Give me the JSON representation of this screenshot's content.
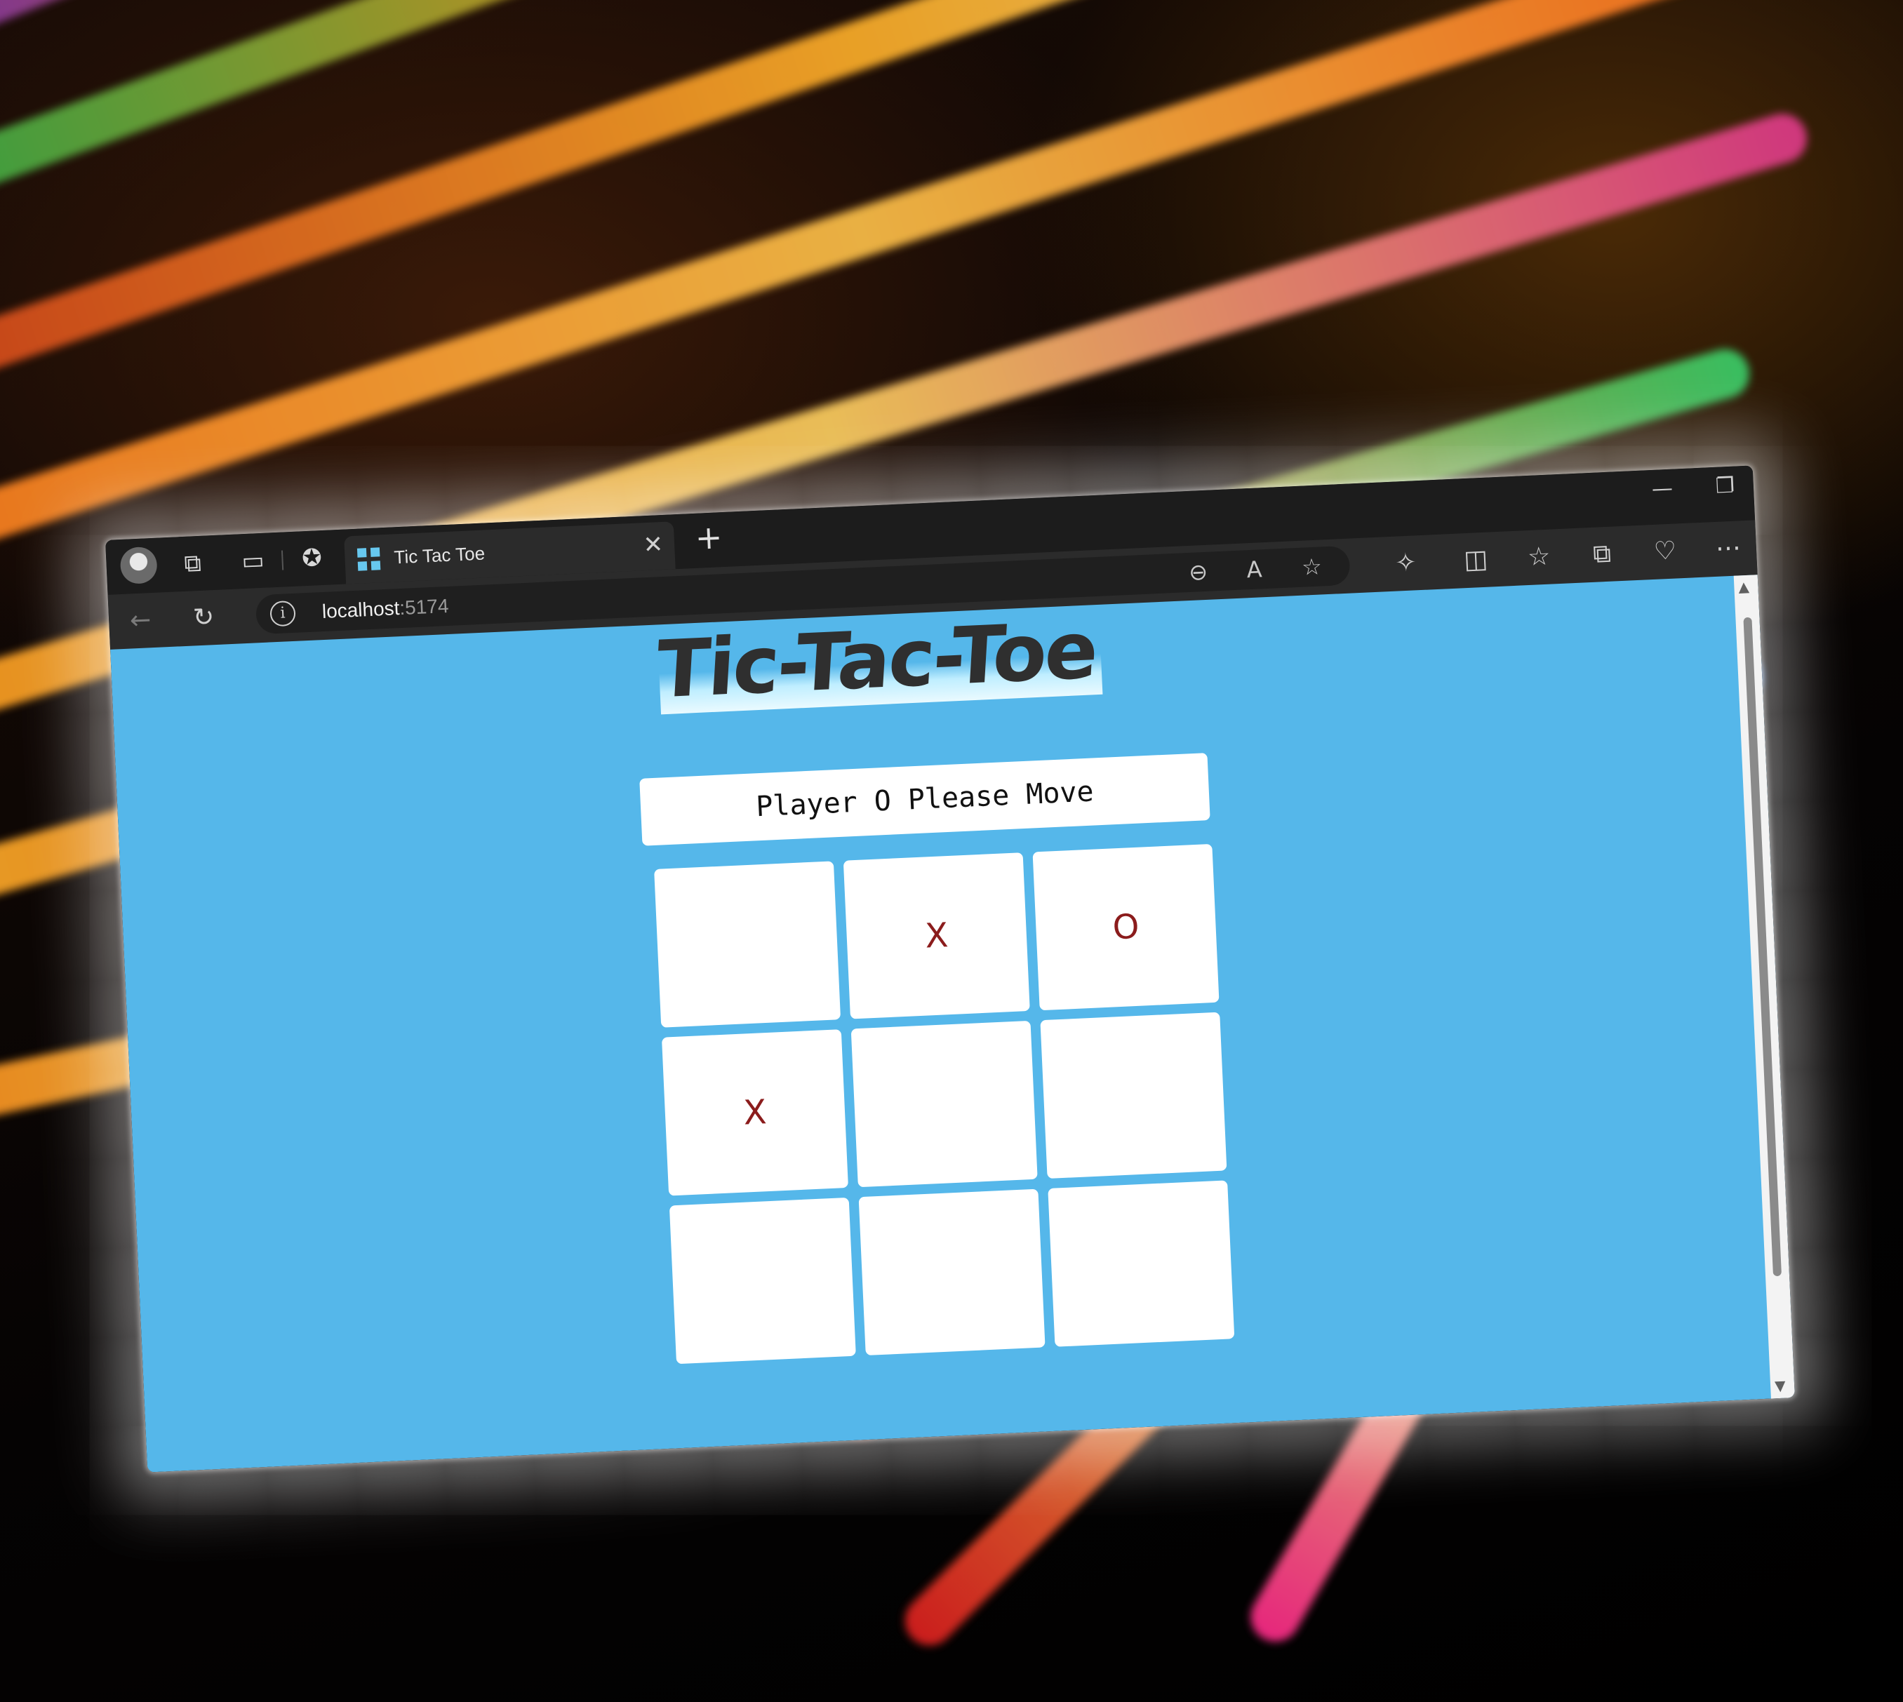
{
  "browser": {
    "tab_title": "Tic Tac Toe",
    "address_host": "localhost",
    "address_port": ":5174"
  },
  "page": {
    "title": "Tic-Tac-Toe",
    "status": "Player O Please Move",
    "board": [
      "",
      "X",
      "O",
      "X",
      "",
      "",
      "",
      "",
      ""
    ]
  },
  "colors": {
    "page_background": "#55b7ea",
    "mark_color": "#8b1c1c",
    "cell_background": "#ffffff"
  },
  "icons": {
    "workspaces": "workspaces-icon",
    "tab_actions": "tab-actions-icon",
    "zoom": "zoom-out-icon",
    "read_aloud": "read-aloud-icon",
    "favorite": "star-icon",
    "extensions": "extensions-icon",
    "split_screen": "split-screen-icon",
    "favorites": "favorites-list-icon",
    "collections": "collections-icon",
    "browser_essentials": "heartbeat-icon",
    "more": "more-icon"
  }
}
